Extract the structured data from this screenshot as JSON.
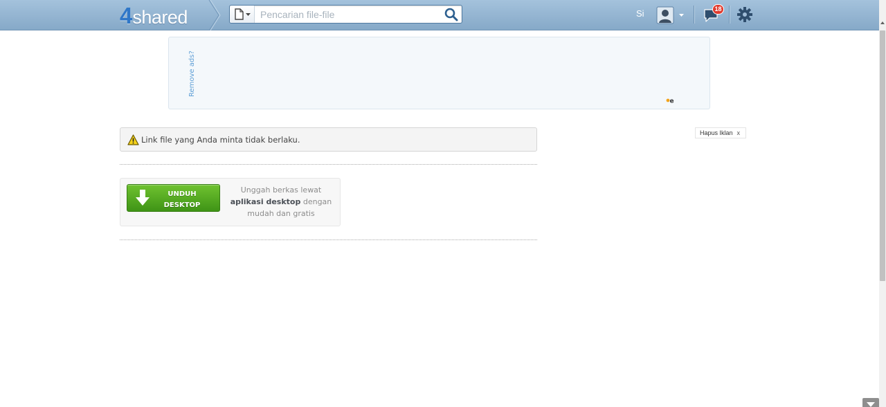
{
  "header": {
    "logo_number": "4",
    "logo_word": "shared",
    "search": {
      "placeholder": "Pencarian file-file",
      "value": ""
    },
    "sign_in_label": "Si",
    "notification_count": "18"
  },
  "ad": {
    "remove_ads_label": "Remove ads?",
    "hide_ad_label": "Hapus Iklan",
    "hide_ad_close": "x"
  },
  "alert": {
    "icon": "warning-icon",
    "message": "Link file yang Anda minta tidak berlaku."
  },
  "promo": {
    "button_line1": "UNDUH",
    "button_line2": "DESKTOP",
    "text_before": "Unggah berkas lewat",
    "text_bold": "aplikasi desktop",
    "text_after": "dengan mudah dan gratis"
  },
  "colors": {
    "header_top": "#a4c2dc",
    "header_bottom": "#86a9c8",
    "logo_accent": "#2f77c8",
    "download_green": "#4fa61e",
    "badge_red": "#e03a2e",
    "link_blue": "#5f9fd6"
  }
}
